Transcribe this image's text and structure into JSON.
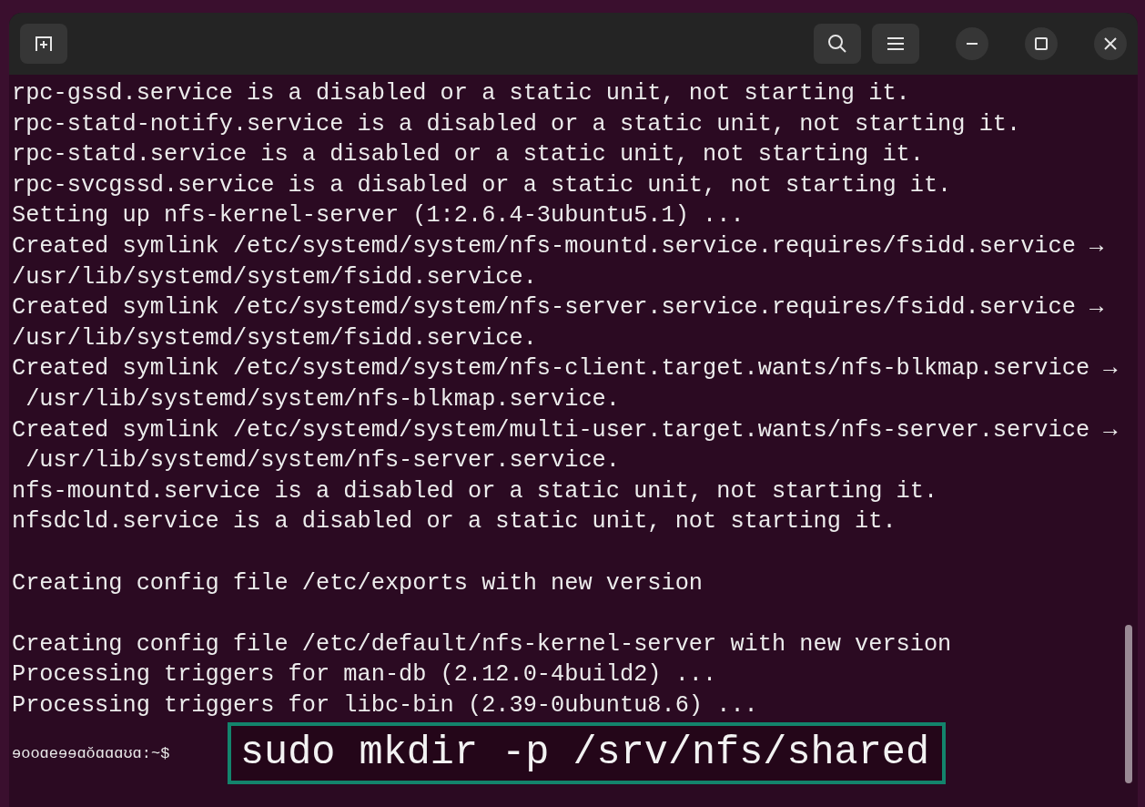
{
  "terminal": {
    "blocks": [
      {
        "lines": [
          "rpc-gssd.service is a disabled or a static unit, not starting it.",
          "rpc-statd-notify.service is a disabled or a static unit, not starting it.",
          "rpc-statd.service is a disabled or a static unit, not starting it.",
          "rpc-svcgssd.service is a disabled or a static unit, not starting it.",
          "Setting up nfs-kernel-server (1:2.6.4-3ubuntu5.1) ...",
          "Created symlink /etc/systemd/system/nfs-mountd.service.requires/fsidd.service →",
          "/usr/lib/systemd/system/fsidd.service.",
          "Created symlink /etc/systemd/system/nfs-server.service.requires/fsidd.service →",
          "/usr/lib/systemd/system/fsidd.service.",
          "Created symlink /etc/systemd/system/nfs-client.target.wants/nfs-blkmap.service →",
          " /usr/lib/systemd/system/nfs-blkmap.service.",
          "Created symlink /etc/systemd/system/multi-user.target.wants/nfs-server.service →",
          " /usr/lib/systemd/system/nfs-server.service.",
          "nfs-mountd.service is a disabled or a static unit, not starting it.",
          "nfsdcld.service is a disabled or a static unit, not starting it."
        ]
      },
      {
        "lines": [
          "Creating config file /etc/exports with new version"
        ]
      },
      {
        "lines": [
          "Creating config file /etc/default/nfs-kernel-server with new version",
          "Processing triggers for man-db (2.12.0-4build2) ...",
          "Processing triggers for libc-bin (2.39-0ubuntu8.6) ..."
        ]
      }
    ],
    "prompt": "ɘooɑeɘɘɑŏɑɑɑʊɑ:~$",
    "highlighted_command": "sudo mkdir -p /srv/nfs/shared"
  }
}
